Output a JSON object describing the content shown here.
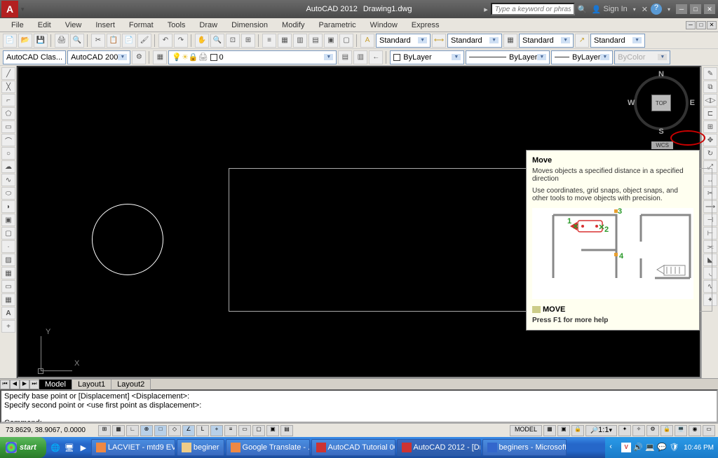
{
  "title": {
    "app": "AutoCAD 2012",
    "doc": "Drawing1.dwg",
    "search_placeholder": "Type a keyword or phrase",
    "signin": "Sign In"
  },
  "menus": [
    "File",
    "Edit",
    "View",
    "Insert",
    "Format",
    "Tools",
    "Draw",
    "Dimension",
    "Modify",
    "Parametric",
    "Window",
    "Express"
  ],
  "styles": {
    "s1": "Standard",
    "s2": "Standard",
    "s3": "Standard",
    "s4": "Standard"
  },
  "workspace": {
    "ws": "AutoCAD Clas...",
    "name": "AutoCAD 200"
  },
  "layer": {
    "current": "0",
    "bylayer1": "ByLayer",
    "bylayer2": "ByLayer",
    "bylayer3": "ByLayer",
    "bycolor": "ByColor"
  },
  "compass": {
    "top": "TOP",
    "n": "N",
    "s": "S",
    "e": "E",
    "w": "W",
    "wcs": "WCS"
  },
  "tooltip": {
    "title": "Move",
    "desc": "Moves objects a specified distance in a specified direction",
    "body": "Use coordinates, grid snaps, object snaps, and other tools to move objects with precision.",
    "cmd": "MOVE",
    "help": "Press F1 for more help",
    "labels": {
      "p1": "1",
      "p2": "2",
      "p3": "3",
      "p4": "4"
    }
  },
  "tabs": {
    "model": "Model",
    "l1": "Layout1",
    "l2": "Layout2"
  },
  "cmd": {
    "l1": "Specify base point or [Displacement] <Displacement>:",
    "l2": "Specify second point or <use first point as displacement>:",
    "l3": "",
    "prompt": "Command:"
  },
  "status": {
    "coords": "73.8629, 38.9067, 0.0000",
    "model": "MODEL",
    "scale": "1:1"
  },
  "taskbar": {
    "start": "start",
    "items": [
      "LACVIET - mtd9 EVA...",
      "beginer",
      "Google Translate - ...",
      "AutoCAD Tutorial 00...",
      "AutoCAD 2012 - [Dr...",
      "beginers - Microsoft ..."
    ],
    "clock": "10:46 PM"
  }
}
